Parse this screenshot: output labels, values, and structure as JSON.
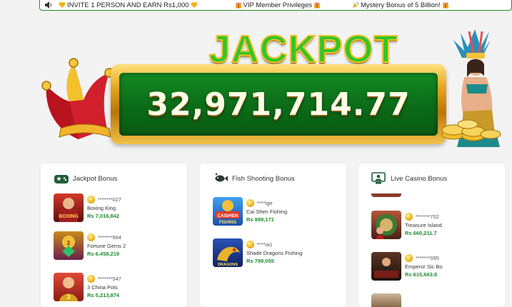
{
  "marquee": {
    "items": [
      {
        "text": "INVITE 1 PERSON AND EARN Rs1,000",
        "icon": "heart-gift-icon"
      },
      {
        "text": "VIP Member Privileges",
        "icon": "gift-box-icon"
      },
      {
        "text": "Mystery Bonus of 5 Billion!",
        "icon": "party-popper-icon"
      }
    ]
  },
  "jackpot": {
    "title": "JACKPOT",
    "amount": "32,971,714.77"
  },
  "sections": [
    {
      "title": "Jackpot Bonus",
      "icon": "gamepad-icon",
      "entries": [
        {
          "user": "*******027",
          "game": "Boxing King",
          "amount": "Rs 7,016,842",
          "thumb_color": "#8b1d1d"
        },
        {
          "user": "*******964",
          "game": "Fortune Gems 2",
          "amount": "Rs 6,458,219",
          "thumb_color": "#7a2b6b"
        },
        {
          "user": "*******547",
          "game": "3 China Pots",
          "amount": "Rs 5,213,874",
          "thumb_color": "#b32a1e"
        }
      ]
    },
    {
      "title": "Fish Shooting Bonus",
      "icon": "fish-icon",
      "entries": [
        {
          "user": "****ige",
          "game": "Cai Shen Fishing",
          "amount": "Rs 989,171",
          "thumb_color": "#1f6bd1"
        },
        {
          "user": "****ia1",
          "game": "Shade Dragons Fishing",
          "amount": "Rs 799,055",
          "thumb_color": "#1d3b88"
        }
      ]
    },
    {
      "title": "Live Casino Bonus",
      "icon": "live-dealer-icon",
      "entries": [
        {
          "user": "*******702",
          "game": "Treasure Island",
          "amount": "Rs 660,211.7",
          "thumb_color": "#7c3a2a"
        },
        {
          "user": "*******095",
          "game": "Emperor Sic Bo",
          "amount": "Rs 615,663.8",
          "thumb_color": "#3a2218"
        }
      ]
    }
  ]
}
